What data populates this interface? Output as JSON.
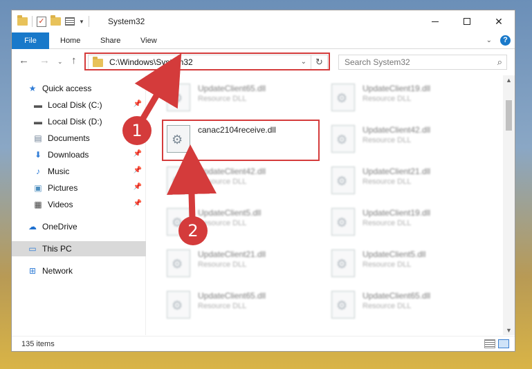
{
  "window": {
    "title": "System32"
  },
  "ribbon": {
    "tabs": [
      "File",
      "Home",
      "Share",
      "View"
    ],
    "help_label": "?"
  },
  "address": {
    "path": "C:\\Windows\\System32",
    "search_placeholder": "Search System32"
  },
  "sidebar": {
    "items": [
      {
        "label": "Quick access",
        "icon": "star-icon"
      },
      {
        "label": "Local Disk (C:)",
        "icon": "drive-icon"
      },
      {
        "label": "Local Disk (D:)",
        "icon": "drive-icon"
      },
      {
        "label": "Documents",
        "icon": "documents-icon"
      },
      {
        "label": "Downloads",
        "icon": "download-arrow-icon"
      },
      {
        "label": "Music",
        "icon": "music-note-icon"
      },
      {
        "label": "Pictures",
        "icon": "pictures-icon"
      },
      {
        "label": "Videos",
        "icon": "film-icon"
      },
      {
        "label": "OneDrive",
        "icon": "cloud-icon"
      },
      {
        "label": "This PC",
        "icon": "monitor-icon"
      },
      {
        "label": "Network",
        "icon": "network-icon"
      }
    ]
  },
  "files": {
    "highlighted": {
      "name": "canac2104receive.dll",
      "desc": ""
    },
    "left_column": [
      {
        "name": "UpdateClient65.dll",
        "desc": "Resource DLL"
      },
      {
        "name": "UpdateClient42.dll",
        "desc": "Resource DLL"
      },
      {
        "name": "UpdateClient5.dll",
        "desc": "Resource DLL"
      },
      {
        "name": "UpdateClient21.dll",
        "desc": "Resource DLL"
      },
      {
        "name": "UpdateClient65.dll",
        "desc": "Resource DLL"
      }
    ],
    "right_column": [
      {
        "name": "UpdateClient19.dll",
        "desc": "Resource DLL"
      },
      {
        "name": "UpdateClient42.dll",
        "desc": "Resource DLL"
      },
      {
        "name": "UpdateClient21.dll",
        "desc": "Resource DLL"
      },
      {
        "name": "UpdateClient19.dll",
        "desc": "Resource DLL"
      },
      {
        "name": "UpdateClient5.dll",
        "desc": "Resource DLL"
      },
      {
        "name": "UpdateClient65.dll",
        "desc": "Resource DLL"
      }
    ]
  },
  "status": {
    "item_count": "135 items"
  },
  "callouts": [
    "1",
    "2"
  ],
  "colors": {
    "accent": "#1979ca",
    "highlight": "#d43b3b"
  }
}
